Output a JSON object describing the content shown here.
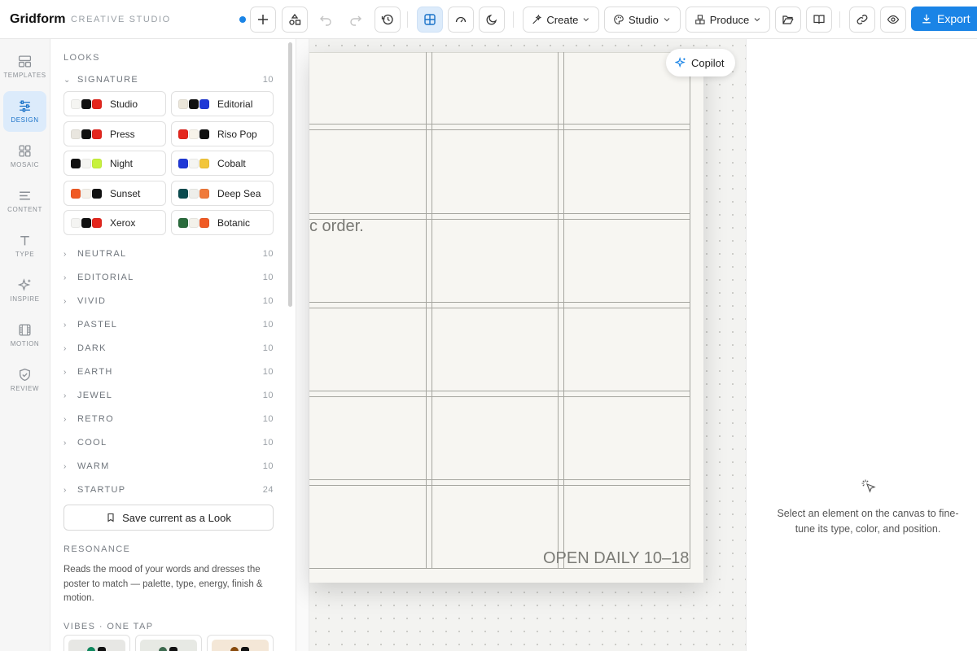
{
  "app": {
    "name": "Gridform",
    "subtitle": "CREATIVE STUDIO"
  },
  "toolbar": {
    "create": "Create",
    "studio": "Studio",
    "produce": "Produce",
    "export": "Export"
  },
  "rail": {
    "items": [
      {
        "label": "TEMPLATES",
        "icon": "templates-icon"
      },
      {
        "label": "DESIGN",
        "icon": "sliders-icon",
        "active": true
      },
      {
        "label": "MOSAIC",
        "icon": "mosaic-icon"
      },
      {
        "label": "CONTENT",
        "icon": "content-icon"
      },
      {
        "label": "TYPE",
        "icon": "type-icon"
      },
      {
        "label": "INSPIRE",
        "icon": "sparkle-icon"
      },
      {
        "label": "MOTION",
        "icon": "film-icon"
      },
      {
        "label": "REVIEW",
        "icon": "shield-icon"
      }
    ]
  },
  "panel": {
    "looks_title": "LOOKS",
    "signature": {
      "label": "SIGNATURE",
      "count": "10",
      "looks": [
        {
          "name": "Studio",
          "colors": [
            "#f5f5f2",
            "#111111",
            "#e4261d"
          ]
        },
        {
          "name": "Editorial",
          "colors": [
            "#ebe6da",
            "#111111",
            "#1f38d6"
          ]
        },
        {
          "name": "Press",
          "colors": [
            "#e9e6df",
            "#111111",
            "#e4261d"
          ]
        },
        {
          "name": "Riso Pop",
          "colors": [
            "#e4261d",
            "#f7f3ea",
            "#111111"
          ]
        },
        {
          "name": "Night",
          "colors": [
            "#111111",
            "#f5f5f2",
            "#c7f23c"
          ]
        },
        {
          "name": "Cobalt",
          "colors": [
            "#1f38d6",
            "#f5f5f2",
            "#f2c63a"
          ]
        },
        {
          "name": "Sunset",
          "colors": [
            "#f05a24",
            "#f5f1ea",
            "#111111"
          ]
        },
        {
          "name": "Deep Sea",
          "colors": [
            "#0b4b4f",
            "#eeeeea",
            "#f07a3a"
          ]
        },
        {
          "name": "Xerox",
          "colors": [
            "#f4f4f2",
            "#111111",
            "#e4261d"
          ]
        },
        {
          "name": "Botanic",
          "colors": [
            "#2a6b3c",
            "#f3f1ea",
            "#f05a24"
          ]
        }
      ]
    },
    "groups": [
      {
        "label": "NEUTRAL",
        "count": "10"
      },
      {
        "label": "EDITORIAL",
        "count": "10"
      },
      {
        "label": "VIVID",
        "count": "10"
      },
      {
        "label": "PASTEL",
        "count": "10"
      },
      {
        "label": "DARK",
        "count": "10"
      },
      {
        "label": "EARTH",
        "count": "10"
      },
      {
        "label": "JEWEL",
        "count": "10"
      },
      {
        "label": "RETRO",
        "count": "10"
      },
      {
        "label": "COOL",
        "count": "10"
      },
      {
        "label": "WARM",
        "count": "10"
      },
      {
        "label": "STARTUP",
        "count": "24"
      }
    ],
    "save_label": "Save current as a Look",
    "resonance_title": "RESONANCE",
    "resonance_desc": "Reads the mood of your words and dresses the poster to match — palette, type, energy, finish & motion.",
    "vibes_title": "VIBES · ONE TAP",
    "vibes": [
      {
        "bg": "#e7e7e4",
        "dots": [
          "#0f8a5f",
          "#111111"
        ]
      },
      {
        "bg": "#e7e9e4",
        "dots": [
          "#3d6b4f",
          "#111111"
        ]
      },
      {
        "bg": "#f4e7d7",
        "dots": [
          "#8a4b0c",
          "#111111"
        ]
      }
    ]
  },
  "canvas": {
    "poster_text_1": "c order.",
    "poster_text_2": "OPEN DAILY 10–18"
  },
  "copilot": {
    "label": "Copilot"
  },
  "inspector": {
    "empty_message": "Select an element on the canvas to fine-tune its type, color, and position."
  },
  "colors": {
    "accent": "#1a84e6",
    "accent_soft": "#dcebfb",
    "poster_bg": "#f7f6f2"
  }
}
